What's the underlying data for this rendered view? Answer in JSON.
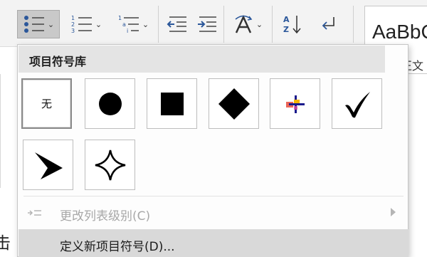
{
  "ribbon": {
    "bullet_list_button": {
      "icon": "bullet-list-icon",
      "state": "open"
    },
    "numbered_list_button": {
      "icon": "numbered-list-icon"
    },
    "multilevel_list_button": {
      "icon": "multilevel-list-icon"
    },
    "decrease_indent_button": {
      "icon": "decrease-indent-icon"
    },
    "increase_indent_button": {
      "icon": "increase-indent-icon"
    },
    "text_direction_button": {
      "icon": "text-direction-icon"
    },
    "sort_button": {
      "icon": "sort-az-icon"
    },
    "show_marks_button": {
      "icon": "paragraph-mark-icon"
    },
    "styles": {
      "sample": "AaBbC",
      "sub": "正文"
    }
  },
  "document": {
    "partial_char": "击"
  },
  "menu": {
    "title": "项目符号库",
    "bullets": [
      {
        "label": "无",
        "icon": "none",
        "selected": true
      },
      {
        "icon": "filled-circle-icon"
      },
      {
        "icon": "filled-square-icon"
      },
      {
        "icon": "filled-diamond-icon"
      },
      {
        "icon": "colorful-cross-icon"
      },
      {
        "icon": "checkmark-icon"
      },
      {
        "icon": "arrowhead-icon"
      },
      {
        "icon": "four-point-star-icon"
      }
    ],
    "items": [
      {
        "label": "更改列表级别(C)",
        "disabled": true,
        "has_submenu": true
      },
      {
        "label": "定义新项目符号(D)...",
        "disabled": false,
        "hover": true
      }
    ]
  },
  "colors": {
    "ribbon_bg": "#f3f3f3",
    "active_button": "#c9c9c9",
    "menu_header": "#e4e4e4",
    "hover_row": "#d9d9d9",
    "icon_blue": "#2b579a"
  }
}
